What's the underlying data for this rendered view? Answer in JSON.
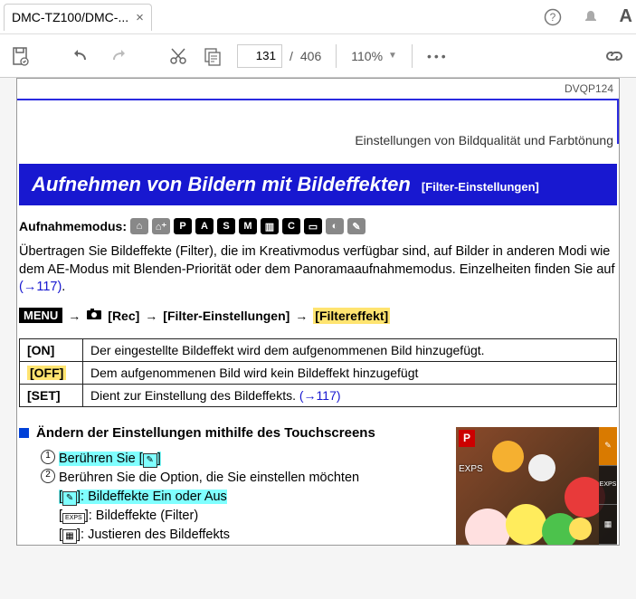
{
  "tab": {
    "title": "DMC-TZ100/DMC-..."
  },
  "toolbar": {
    "page_current": "131",
    "page_sep": "/",
    "page_total": "406",
    "zoom": "110%"
  },
  "runhead": {
    "code": "DVQP124"
  },
  "breadcrumb": "Einstellungen von Bildqualität und Farbtönung",
  "header": {
    "title": "Aufnehmen von Bildern mit Bildeffekten",
    "sub": "[Filter-Einstellungen]"
  },
  "modes_label": "Aufnahmemodus:",
  "mode_letters": [
    "",
    "",
    "P",
    "A",
    "S",
    "M",
    "",
    "C",
    "",
    "",
    ""
  ],
  "intro": "Übertragen Sie Bildeffekte (Filter), die im Kreativmodus verfügbar sind, auf Bilder in anderen Modi wie dem AE-Modus mit Blenden-Priorität oder dem Panoramaaufnahmemodus. Einzelheiten finden Sie auf ",
  "intro_link": "(→117)",
  "intro_end": ".",
  "menupath": {
    "menu": "MENU",
    "rec": "[Rec]",
    "filter_settings": "[Filter-Einstellungen]",
    "filter_effect": "[Filtereffekt]"
  },
  "table": [
    {
      "k": "[ON]",
      "v": "Der eingestellte Bildeffekt wird dem aufgenommenen Bild hinzugefügt."
    },
    {
      "k": "[OFF]",
      "v": "Dem aufgenommenen Bild wird kein Bildeffekt hinzugefügt"
    },
    {
      "k": "[SET]",
      "v": "Dient zur Einstellung des Bildeffekts. ",
      "link": "(→117)"
    }
  ],
  "section": "Ändern der Einstellungen mithilfe des Touchscreens",
  "steps": {
    "s1_a": "Berühren Sie [",
    "s1_icon": "✎",
    "s1_b": "]",
    "s2": "Berühren Sie die Option, die Sie einstellen möchten",
    "s2a_icon": "✎",
    "s2a": "]: Bildeffekte Ein oder Aus",
    "s2b_icon": "EXPS",
    "s2b": "]: Bildeffekte (Filter)",
    "s2c_icon": "▦",
    "s2c": "]: Justieren des Bildeffekts"
  },
  "thumb": {
    "p": "P",
    "exps": "EXPS",
    "side": [
      "✎",
      "EXPS",
      "▦"
    ]
  }
}
